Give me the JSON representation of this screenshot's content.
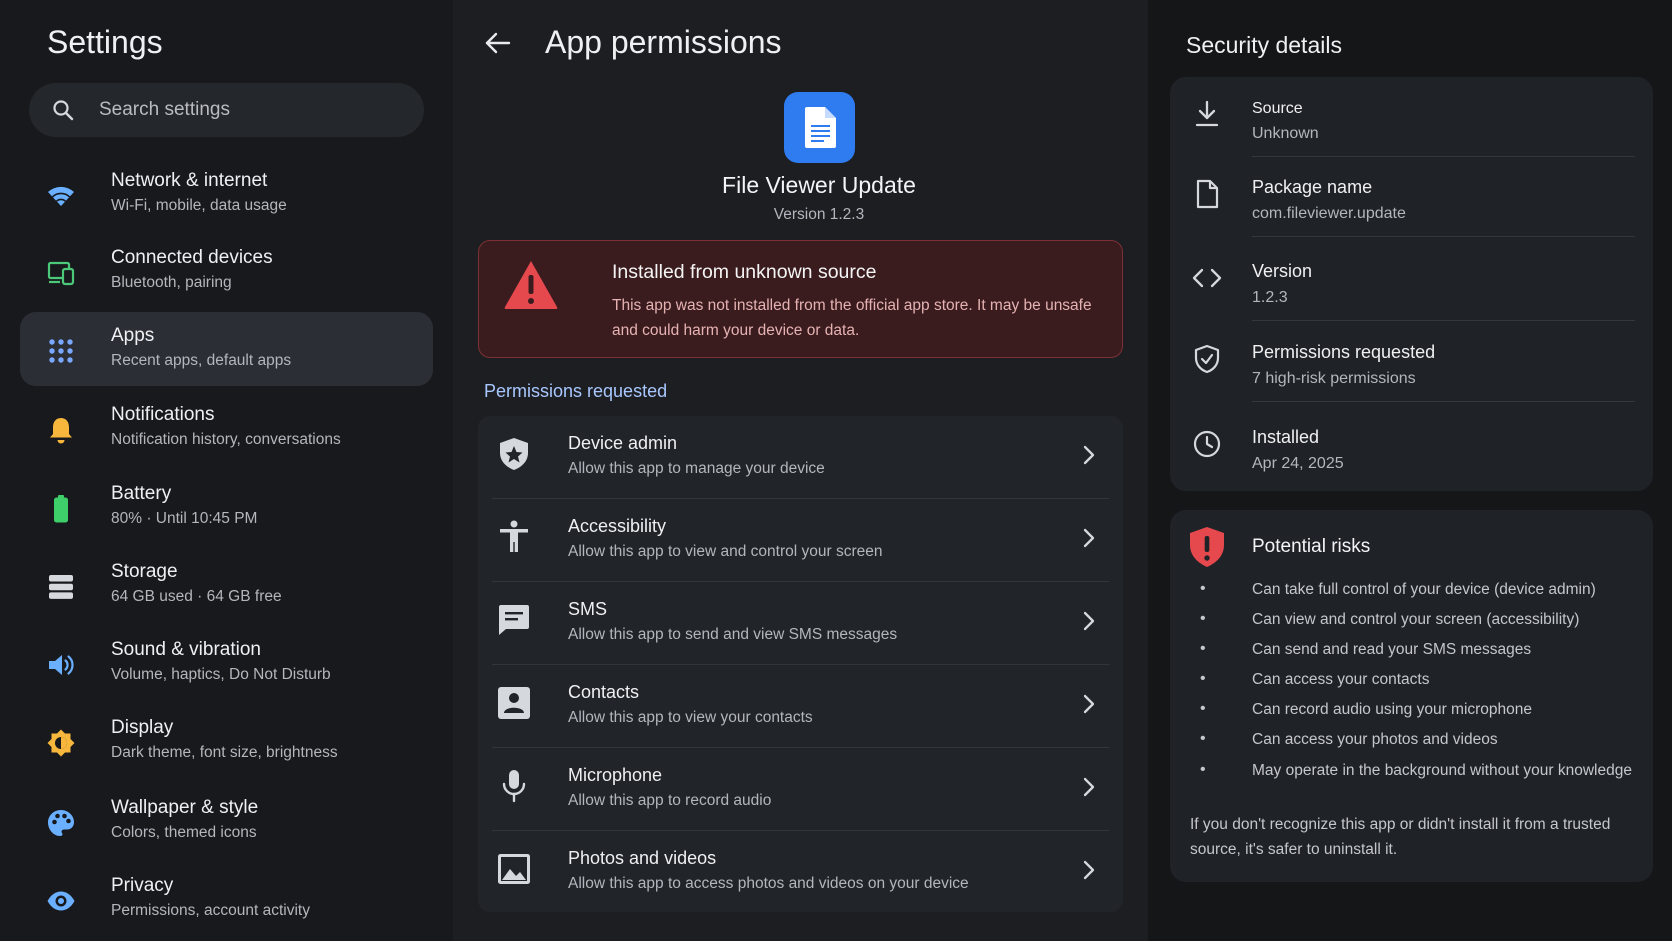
{
  "sidebar": {
    "title": "Settings",
    "search_placeholder": "Search settings",
    "items": [
      {
        "label": "Network & internet",
        "sub": "Wi-Fi, mobile, data usage",
        "icon": "wifi-icon",
        "color": "#6ab0ff"
      },
      {
        "label": "Connected devices",
        "sub": "Bluetooth, pairing",
        "icon": "devices-icon",
        "color": "#4cc879"
      },
      {
        "label": "Apps",
        "sub": "Recent apps, default apps",
        "icon": "apps-grid-icon",
        "color": "#7aa7ff",
        "active": true
      },
      {
        "label": "Notifications",
        "sub": "Notification history, conversations",
        "icon": "bell-icon",
        "color": "#f6b73c"
      },
      {
        "label": "Battery",
        "sub": "80% · Until 10:45 PM",
        "icon": "battery-icon",
        "color": "#3ecf6a"
      },
      {
        "label": "Storage",
        "sub": "64 GB used · 64 GB free",
        "icon": "storage-icon",
        "color": "#d5d8dc"
      },
      {
        "label": "Sound & vibration",
        "sub": "Volume, haptics, Do Not Disturb",
        "icon": "volume-icon",
        "color": "#6ab0ff"
      },
      {
        "label": "Display",
        "sub": "Dark theme, font size, brightness",
        "icon": "brightness-icon",
        "color": "#f6b73c"
      },
      {
        "label": "Wallpaper & style",
        "sub": "Colors, themed icons",
        "icon": "palette-icon",
        "color": "#6ab0ff"
      },
      {
        "label": "Privacy",
        "sub": "Permissions, account activity",
        "icon": "eye-icon",
        "color": "#6ab0ff"
      }
    ]
  },
  "main": {
    "title": "App permissions",
    "app": {
      "name": "File Viewer Update",
      "version": "Version 1.2.3"
    },
    "warning": {
      "title": "Installed from unknown source",
      "text": "This app was not installed from the official app store. It may be unsafe and could harm your device or data."
    },
    "permissions_heading": "Permissions requested",
    "permissions": [
      {
        "name": "Device admin",
        "desc": "Allow this app to manage your device",
        "icon": "shield-icon"
      },
      {
        "name": "Accessibility",
        "desc": "Allow this app to view and control your screen",
        "icon": "accessibility-icon"
      },
      {
        "name": "SMS",
        "desc": "Allow this app to send and view SMS messages",
        "icon": "sms-icon"
      },
      {
        "name": "Contacts",
        "desc": "Allow this app to view your contacts",
        "icon": "contacts-icon"
      },
      {
        "name": "Microphone",
        "desc": "Allow this app to record audio",
        "icon": "microphone-icon"
      },
      {
        "name": "Photos and videos",
        "desc": "Allow this app to access photos and videos on your device",
        "icon": "photo-icon"
      }
    ]
  },
  "details": {
    "title": "Security details",
    "rows": [
      {
        "label": "Source",
        "value": "Unknown",
        "icon": "download-icon"
      },
      {
        "label": "Package name",
        "value": "com.fileviewer.update",
        "icon": "file-icon"
      },
      {
        "label": "Version",
        "value": "1.2.3",
        "icon": "code-icon"
      },
      {
        "label": "Permissions requested",
        "value": "7 high-risk permissions",
        "icon": "shield-check-icon"
      },
      {
        "label": "Installed",
        "value": "Apr 24, 2025",
        "icon": "clock-icon"
      }
    ]
  },
  "risks": {
    "title": "Potential risks",
    "items": [
      "Can take full control of your device (device admin)",
      "Can view and control your screen (accessibility)",
      "Can send and read your SMS messages",
      "Can access your contacts",
      "Can record audio using your microphone",
      "Can access your photos and videos",
      "May operate in the background without your knowledge"
    ],
    "note": "If you don't recognize this app or didn't install it from a trusted source, it's safer to uninstall it."
  },
  "colors": {
    "accent": "#2f7bf0",
    "danger": "#e5484d",
    "heading": "#a9c7ff"
  }
}
